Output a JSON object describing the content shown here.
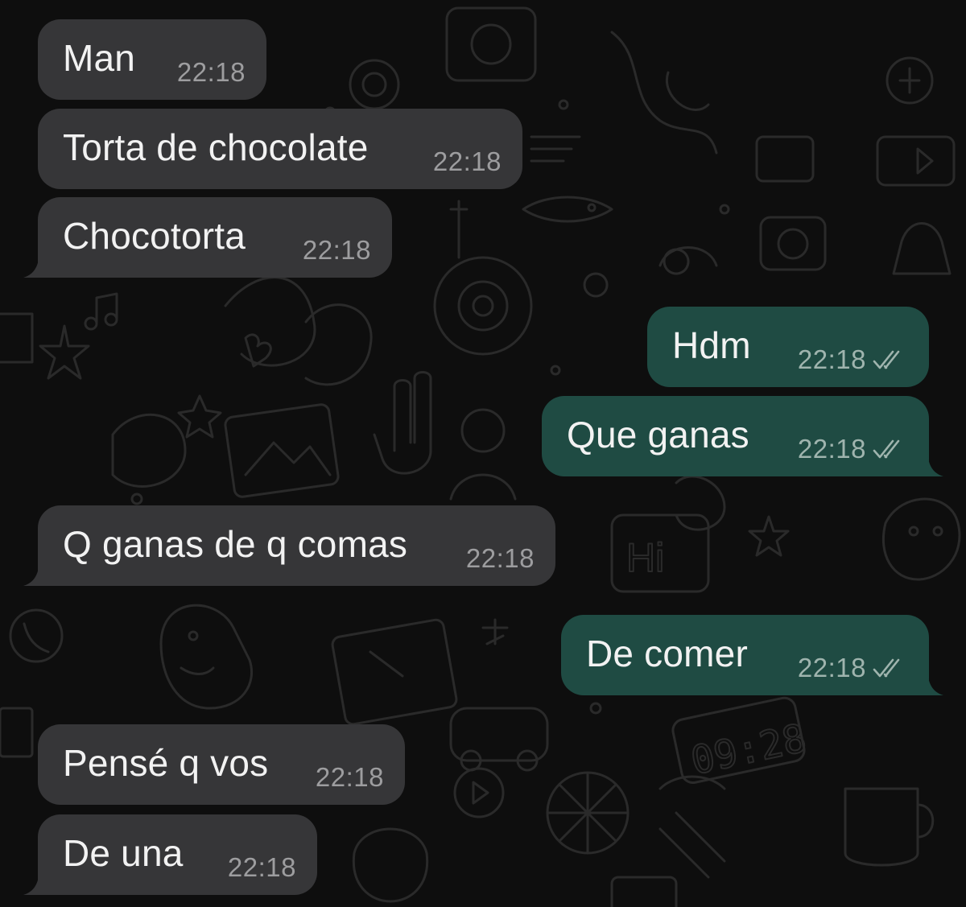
{
  "colors": {
    "background": "#0e0e0e",
    "incoming_bubble": "#363638",
    "outgoing_bubble": "#1f4b43",
    "text": "#f2f2f2",
    "time_incoming": "#9d9d9f",
    "time_outgoing": "#9fb4ae",
    "read_check": "#9fb4ae"
  },
  "messages": [
    {
      "direction": "incoming",
      "text": "Man",
      "time": "22:18"
    },
    {
      "direction": "incoming",
      "text": "Torta de chocolate",
      "time": "22:18"
    },
    {
      "direction": "incoming",
      "text": "Chocotorta",
      "time": "22:18"
    },
    {
      "direction": "outgoing",
      "text": "Hdm",
      "time": "22:18",
      "status_icon": "double-check-icon"
    },
    {
      "direction": "outgoing",
      "text": "Que ganas",
      "time": "22:18",
      "status_icon": "double-check-icon"
    },
    {
      "direction": "incoming",
      "text": "Q ganas de q comas",
      "time": "22:18"
    },
    {
      "direction": "outgoing",
      "text": "De comer",
      "time": "22:18",
      "status_icon": "double-check-icon"
    },
    {
      "direction": "incoming",
      "text": "Pensé q vos",
      "time": "22:18"
    },
    {
      "direction": "incoming",
      "text": "De una",
      "time": "22:18"
    }
  ]
}
